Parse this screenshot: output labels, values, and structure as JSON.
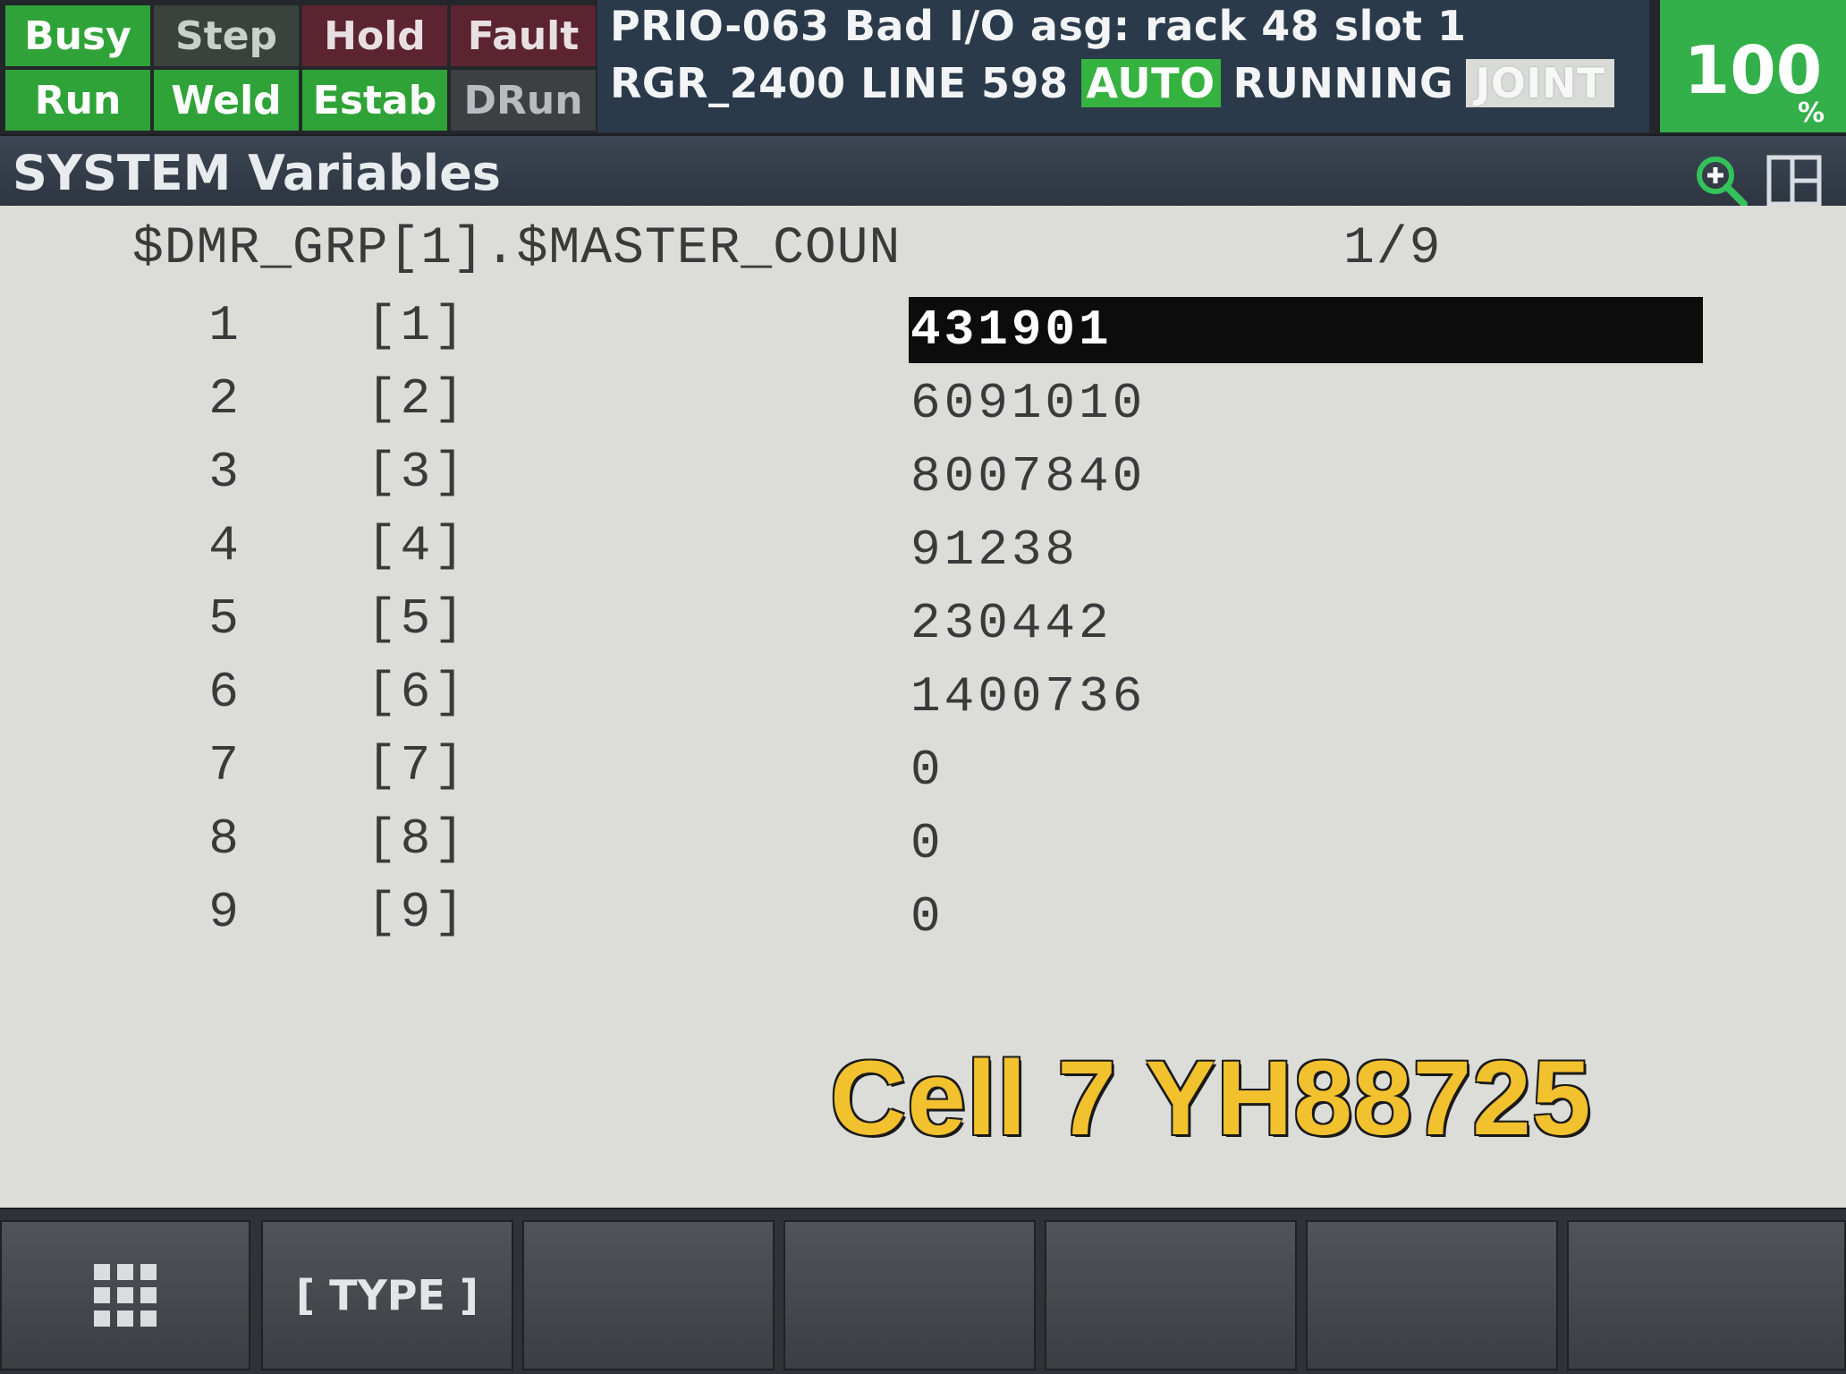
{
  "status_buttons": {
    "busy": "Busy",
    "step": "Step",
    "hold": "Hold",
    "fault": "Fault",
    "run": "Run",
    "weld": "Weld",
    "estab": "Estab",
    "drun": "DRun"
  },
  "alarm": {
    "line1": "PRIO-063 Bad I/O asg: rack 48 slot 1",
    "program_line": "RGR_2400 LINE 598",
    "mode": "AUTO",
    "state": "RUNNING",
    "coord": "JOINT"
  },
  "override": {
    "value": "100",
    "unit": "%"
  },
  "title": "SYSTEM Variables",
  "header": {
    "variable": "$DMR_GRP[1].$MASTER_COUN",
    "page": "1/9"
  },
  "rows": [
    {
      "num": "1",
      "index": "[1]",
      "value": "431901"
    },
    {
      "num": "2",
      "index": "[2]",
      "value": "6091010"
    },
    {
      "num": "3",
      "index": "[3]",
      "value": "8007840"
    },
    {
      "num": "4",
      "index": "[4]",
      "value": "91238"
    },
    {
      "num": "5",
      "index": "[5]",
      "value": "230442"
    },
    {
      "num": "6",
      "index": "[6]",
      "value": "1400736"
    },
    {
      "num": "7",
      "index": "[7]",
      "value": "0"
    },
    {
      "num": "8",
      "index": "[8]",
      "value": "0"
    },
    {
      "num": "9",
      "index": "[9]",
      "value": "0"
    }
  ],
  "selected_row": 1,
  "watermark": "Cell 7 YH88725",
  "fkeys": {
    "menu_icon": "grid-menu-icon",
    "f1": "[ TYPE ]"
  },
  "colors": {
    "status_on": "#2fa338",
    "auto_badge": "#35b23f",
    "watermark": "#f2c12e"
  }
}
